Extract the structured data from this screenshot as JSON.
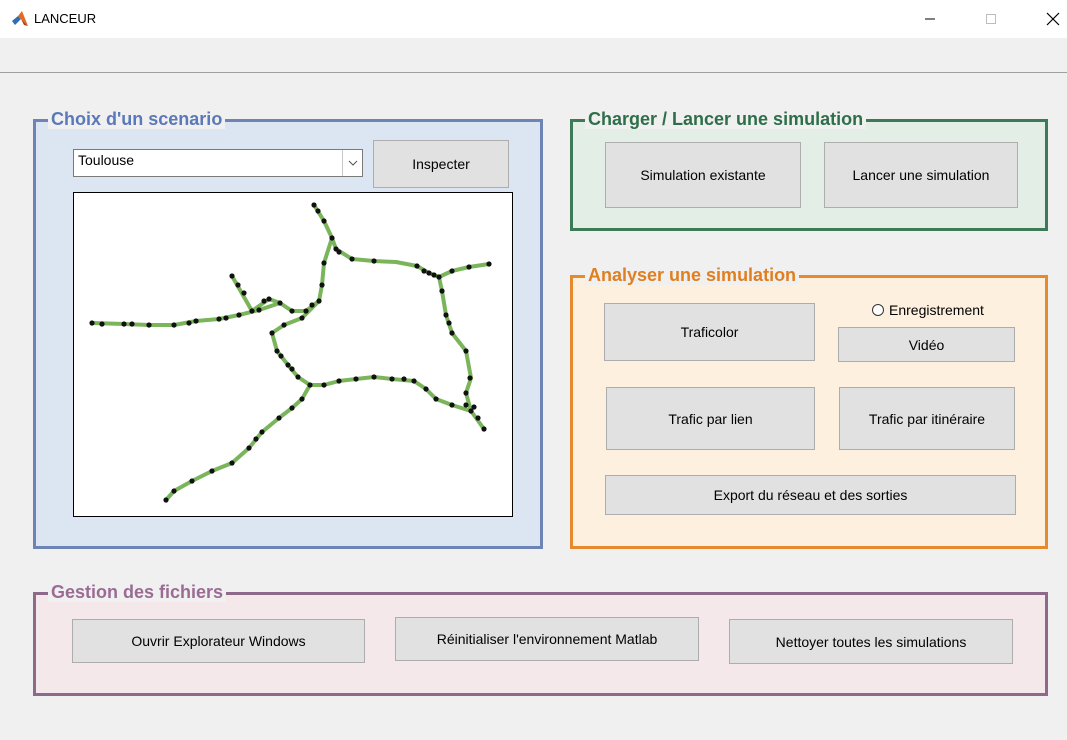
{
  "window": {
    "title": "LANCEUR",
    "minimize_icon": "minimize-icon",
    "maximize_icon": "maximize-icon",
    "close_icon": "close-icon",
    "app_icon": "matlab-logo-icon"
  },
  "colors": {
    "scenario_border": "#6d84b4",
    "scenario_bg": "#dce6f2",
    "scenario_title": "#5b78b8",
    "charger_border": "#3e7a58",
    "charger_bg": "#e3efe6",
    "charger_title": "#2e6f49",
    "analyser_border": "#e58a2e",
    "analyser_bg": "#fdf0de",
    "analyser_title": "#e07f1f",
    "gestion_border": "#8e6a8a",
    "gestion_bg": "#f4e8ea",
    "gestion_title": "#9b6b94",
    "road_line": "#7ab55c",
    "road_node": "#111111"
  },
  "scenario": {
    "title": "Choix d'un scenario",
    "selected": "Toulouse",
    "inspect_label": "Inspecter"
  },
  "charger": {
    "title": "Charger / Lancer une simulation",
    "existing_label": "Simulation existante",
    "launch_label": "Lancer une simulation"
  },
  "analyser": {
    "title": "Analyser une simulation",
    "traficolor_label": "Traficolor",
    "recording_label": "Enregistrement",
    "video_label": "Vidéo",
    "per_link_label": "Trafic par lien",
    "per_route_label": "Trafic par itinéraire",
    "export_label": "Export du réseau et des sorties"
  },
  "gestion": {
    "title": "Gestion des fichiers",
    "explorer_label": "Ouvrir Explorateur Windows",
    "reset_label": "Réinitialiser l'environnement Matlab",
    "clean_label": "Nettoyer toutes les simulations"
  }
}
